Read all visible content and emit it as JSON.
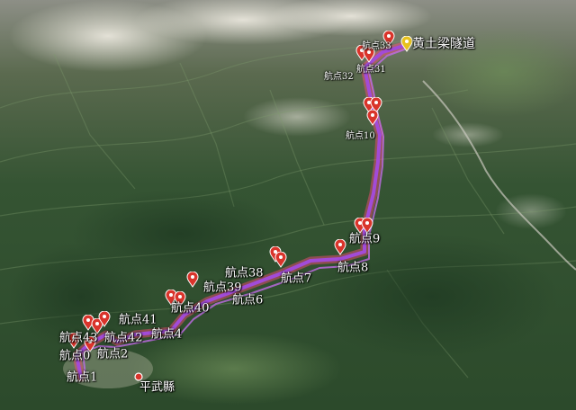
{
  "colors": {
    "route_stroke": "#a24bd8",
    "route_glow": "#ff4d7a",
    "pin": "#d9342b",
    "pin_ring": "#ffffff",
    "label": "#ffffff"
  },
  "places": {
    "tunnel": "黄土梁隧道",
    "county": "平武縣"
  },
  "waypoints": [
    {
      "id": "wp-0",
      "label": "航点0"
    },
    {
      "id": "wp-1",
      "label": "航点1"
    },
    {
      "id": "wp-2",
      "label": "航点2"
    },
    {
      "id": "wp-4",
      "label": "航点4"
    },
    {
      "id": "wp-6",
      "label": "航点6"
    },
    {
      "id": "wp-7",
      "label": "航点7"
    },
    {
      "id": "wp-8",
      "label": "航点8"
    },
    {
      "id": "wp-9",
      "label": "航点9"
    },
    {
      "id": "wp-38",
      "label": "航点38"
    },
    {
      "id": "wp-39",
      "label": "航点39"
    },
    {
      "id": "wp-40",
      "label": "航点40"
    },
    {
      "id": "wp-41",
      "label": "航点41"
    },
    {
      "id": "wp-42",
      "label": "航点42"
    },
    {
      "id": "wp-43",
      "label": "航点43"
    },
    {
      "id": "wp-10",
      "label": "航点10"
    },
    {
      "id": "wp-31",
      "label": "航点31"
    },
    {
      "id": "wp-32",
      "label": "航点32"
    },
    {
      "id": "wp-33",
      "label": "航点33"
    }
  ]
}
